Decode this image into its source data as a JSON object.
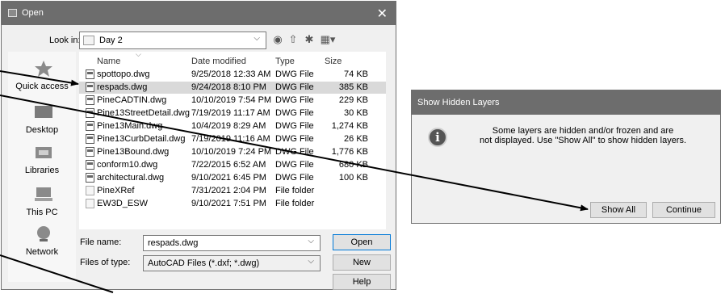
{
  "open_dialog": {
    "title": "Open",
    "close_glyph": "✕",
    "look_in_label": "Look in:",
    "look_in_value": "Day 2",
    "places": [
      {
        "label": "Quick access",
        "icon": "quick-access-star-icon"
      },
      {
        "label": "Desktop",
        "icon": "desktop-icon"
      },
      {
        "label": "Libraries",
        "icon": "libraries-icon"
      },
      {
        "label": "This PC",
        "icon": "this-pc-icon"
      },
      {
        "label": "Network",
        "icon": "network-icon"
      }
    ],
    "columns": {
      "name": "Name",
      "date": "Date modified",
      "type": "Type",
      "size": "Size"
    },
    "files": [
      {
        "name": "spottopo.dwg",
        "date": "9/25/2018 12:33 AM",
        "type": "DWG File",
        "size": "74 KB"
      },
      {
        "name": "respads.dwg",
        "date": "9/24/2018 8:10 PM",
        "type": "DWG File",
        "size": "385 KB"
      },
      {
        "name": "PineCADTIN.dwg",
        "date": "10/10/2019 7:54 PM",
        "type": "DWG File",
        "size": "229 KB"
      },
      {
        "name": "Pine13StreetDetail.dwg",
        "date": "7/19/2019 11:17 AM",
        "type": "DWG File",
        "size": "30 KB"
      },
      {
        "name": "Pine13Main.dwg",
        "date": "10/4/2019 8:29 AM",
        "type": "DWG File",
        "size": "1,274 KB"
      },
      {
        "name": "Pine13CurbDetail.dwg",
        "date": "7/19/2019 11:16 AM",
        "type": "DWG File",
        "size": "26 KB"
      },
      {
        "name": "Pine13Bound.dwg",
        "date": "10/10/2019 7:24 PM",
        "type": "DWG File",
        "size": "1,776 KB"
      },
      {
        "name": "conform10.dwg",
        "date": "7/22/2015 6:52 AM",
        "type": "DWG File",
        "size": "680 KB"
      },
      {
        "name": "architectural.dwg",
        "date": "9/10/2021 6:45 PM",
        "type": "DWG File",
        "size": "100 KB"
      },
      {
        "name": "PineXRef",
        "date": "7/31/2021 2:04 PM",
        "type": "File folder",
        "size": ""
      },
      {
        "name": "EW3D_ESW",
        "date": "9/10/2021 7:51 PM",
        "type": "File folder",
        "size": ""
      }
    ],
    "selected_file": "respads.dwg",
    "file_name_label": "File name:",
    "file_name_value": "respads.dwg",
    "file_type_label": "Files of type:",
    "file_type_value": "AutoCAD Files (*.dxf; *.dwg)",
    "open_button": "Open",
    "new_button": "New",
    "help_button": "Help"
  },
  "hidden_layers_dialog": {
    "title": "Show Hidden Layers",
    "message_line1": "Some layers are hidden and/or frozen and are",
    "message_line2": "not displayed. Use \"Show All\" to show hidden layers.",
    "show_all_button": "Show All",
    "continue_button": "Continue"
  },
  "colors": {
    "title_bar": "#6d6d6d",
    "dialog_bg": "#f0f0f0",
    "selection": "#d9d9d9",
    "arrow": "#000000"
  }
}
